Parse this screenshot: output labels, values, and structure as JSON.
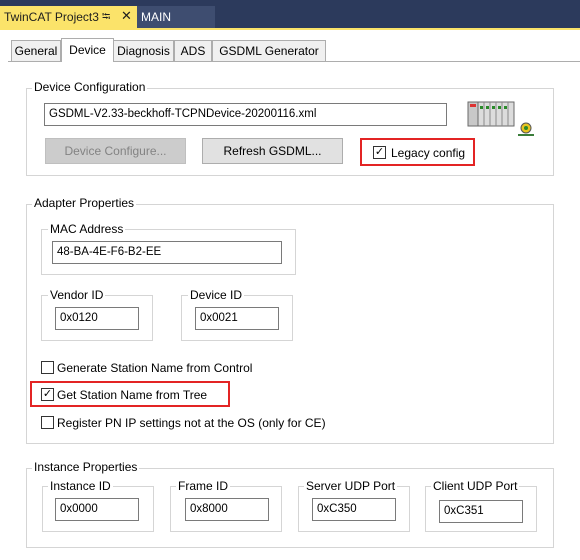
{
  "document_tabs": [
    {
      "label": "TwinCAT Project3",
      "active": true
    },
    {
      "label": "MAIN",
      "active": false
    }
  ],
  "property_tabs": [
    {
      "label": "General"
    },
    {
      "label": "Device",
      "active": true
    },
    {
      "label": "Diagnosis"
    },
    {
      "label": "ADS"
    },
    {
      "label": "GSDML Generator"
    }
  ],
  "device_configuration": {
    "group_label": "Device Configuration",
    "file": "GSDML-V2.33-beckhoff-TCPNDevice-20200116.xml",
    "configure_button": "Device Configure...",
    "refresh_button": "Refresh GSDML...",
    "legacy_config": {
      "label": "Legacy config",
      "checked": true
    },
    "icon": "profinet-device-icon"
  },
  "adapter_properties": {
    "group_label": "Adapter Properties",
    "mac_address": {
      "label": "MAC Address",
      "value": "48-BA-4E-F6-B2-EE"
    },
    "vendor_id": {
      "label": "Vendor ID",
      "value": "0x0120"
    },
    "device_id": {
      "label": "Device ID",
      "value": "0x0021"
    },
    "generate_station_name": {
      "label": "Generate Station Name from Control",
      "checked": false
    },
    "get_station_name": {
      "label": "Get Station Name from Tree",
      "checked": true
    },
    "register_pn_ip": {
      "label": "Register PN IP settings not at the OS (only for CE)",
      "checked": false
    }
  },
  "instance_properties": {
    "group_label": "Instance Properties",
    "instance_id": {
      "label": "Instance ID",
      "value": "0x0000"
    },
    "frame_id": {
      "label": "Frame ID",
      "value": "0x8000"
    },
    "server_udp_port": {
      "label": "Server UDP Port",
      "value": "0xC350"
    },
    "client_udp_port": {
      "label": "Client UDP Port",
      "value": "0xC351"
    }
  },
  "colors": {
    "doc_tab_active": "#fbe36a",
    "doc_strip": "#2c3a5c",
    "highlight_box": "#e32424"
  }
}
